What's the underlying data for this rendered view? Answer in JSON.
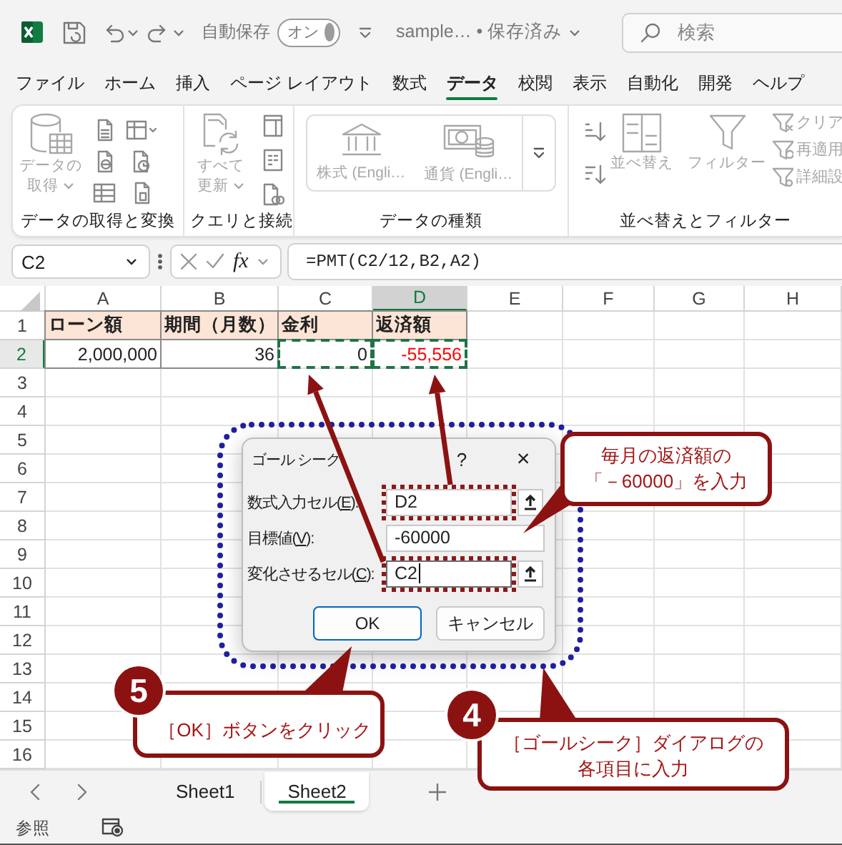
{
  "title_bar": {
    "autosave_label": "自動保存",
    "autosave": {
      "label": "オン",
      "on": true
    },
    "document_title": "sample… • 保存済み",
    "search": {
      "placeholder": "検索"
    }
  },
  "menu_tabs": [
    {
      "label": "ファイル",
      "selected": false
    },
    {
      "label": "ホーム",
      "selected": false
    },
    {
      "label": "挿入",
      "selected": false
    },
    {
      "label": "ページ レイアウト",
      "selected": false
    },
    {
      "label": "数式",
      "selected": false
    },
    {
      "label": "データ",
      "selected": true
    },
    {
      "label": "校閲",
      "selected": false
    },
    {
      "label": "表示",
      "selected": false
    },
    {
      "label": "自動化",
      "selected": false
    },
    {
      "label": "開発",
      "selected": false
    },
    {
      "label": "ヘルプ",
      "selected": false
    }
  ],
  "ribbon": {
    "groups": [
      {
        "label": "データの取得と変換",
        "buttons": [
          {
            "label": "データの取得",
            "disabled": true,
            "dropdown": true
          }
        ]
      },
      {
        "label": "クエリと接続",
        "buttons": [
          {
            "label": "すべて更新",
            "disabled": true,
            "dropdown": true
          }
        ]
      },
      {
        "label": "データの種類",
        "buttons": [
          {
            "label": "株式 (Engli…",
            "disabled": true,
            "dropdown": false
          },
          {
            "label": "通貨 (Engli…",
            "disabled": true,
            "dropdown": false
          }
        ]
      },
      {
        "label": "並べ替えとフィルター",
        "buttons": [
          {
            "label": "並べ替え",
            "disabled": true,
            "dropdown": false
          },
          {
            "label": "フィルター",
            "disabled": true,
            "dropdown": false
          },
          {
            "label": "クリア",
            "disabled": true,
            "dropdown": false
          },
          {
            "label": "再適用",
            "disabled": true,
            "dropdown": false
          },
          {
            "label": "詳細設",
            "disabled": true,
            "dropdown": false
          }
        ]
      }
    ]
  },
  "formula_bar": {
    "name_box": "C2",
    "insert_function": "fx",
    "formula": "=PMT(C2/12,B2,A2)"
  },
  "sheet": {
    "columns": [
      {
        "label": "A",
        "selected": false
      },
      {
        "label": "B",
        "selected": false
      },
      {
        "label": "C",
        "selected": false
      },
      {
        "label": "D",
        "selected": true
      },
      {
        "label": "E",
        "selected": false
      },
      {
        "label": "F",
        "selected": false
      },
      {
        "label": "G",
        "selected": false
      },
      {
        "label": "H",
        "selected": false
      }
    ],
    "rows": [
      {
        "header": "1",
        "selected": false,
        "cells": [
          {
            "text": "ローン額",
            "kind": "header",
            "negative": false,
            "marquee": false
          },
          {
            "text": "期間（月数）",
            "kind": "header",
            "negative": false,
            "marquee": false
          },
          {
            "text": "金利",
            "kind": "header",
            "negative": false,
            "marquee": false
          },
          {
            "text": "返済額",
            "kind": "header",
            "negative": false,
            "marquee": false
          }
        ]
      },
      {
        "header": "2",
        "selected": true,
        "cells": [
          {
            "text": "2,000,000",
            "kind": "number",
            "negative": false,
            "marquee": false
          },
          {
            "text": "36",
            "kind": "number",
            "negative": false,
            "marquee": false
          },
          {
            "text": "0",
            "kind": "number",
            "negative": false,
            "marquee": true
          },
          {
            "text": "-55,556",
            "kind": "number",
            "negative": true,
            "marquee": true
          }
        ]
      },
      {
        "header": "3",
        "selected": false
      },
      {
        "header": "4",
        "selected": false
      },
      {
        "header": "5",
        "selected": false
      },
      {
        "header": "6",
        "selected": false
      },
      {
        "header": "7",
        "selected": false
      },
      {
        "header": "8",
        "selected": false
      },
      {
        "header": "9",
        "selected": false
      },
      {
        "header": "10",
        "selected": false
      },
      {
        "header": "11",
        "selected": false
      },
      {
        "header": "12",
        "selected": false
      },
      {
        "header": "13",
        "selected": false
      },
      {
        "header": "14",
        "selected": false
      },
      {
        "header": "15",
        "selected": false
      },
      {
        "header": "16",
        "selected": false
      }
    ]
  },
  "sheet_tabs": [
    {
      "label": "Sheet1",
      "selected": false
    },
    {
      "label": "Sheet2",
      "selected": true
    }
  ],
  "status_bar": {
    "mode": "参照"
  },
  "goal_seek_dialog": {
    "title": "ゴール シーク",
    "help": "?",
    "close": "×",
    "fields": [
      {
        "label_before": "数式入力セル(",
        "access_key": "E",
        "label_after": "):",
        "value": "D2",
        "kind": "ref",
        "focused": false,
        "highlighted": true
      },
      {
        "label_before": "目標値(",
        "access_key": "V",
        "label_after": "):",
        "value": "-60000",
        "kind": "value",
        "focused": false,
        "highlighted": false
      },
      {
        "label_before": "変化させるセル(",
        "access_key": "C",
        "label_after": "):",
        "value": "C2",
        "kind": "ref",
        "focused": true,
        "highlighted": true
      }
    ],
    "buttons": [
      {
        "label": "OK",
        "default": true
      },
      {
        "label": "キャンセル",
        "default": false
      }
    ]
  },
  "callouts": [
    {
      "text": "毎月の返済額の「－60000」を入力"
    },
    {
      "step": "5",
      "text": "［OK］ボタンをクリック"
    },
    {
      "step": "4",
      "text": "［ゴールシーク］ダイアログの各項目に入力"
    }
  ]
}
